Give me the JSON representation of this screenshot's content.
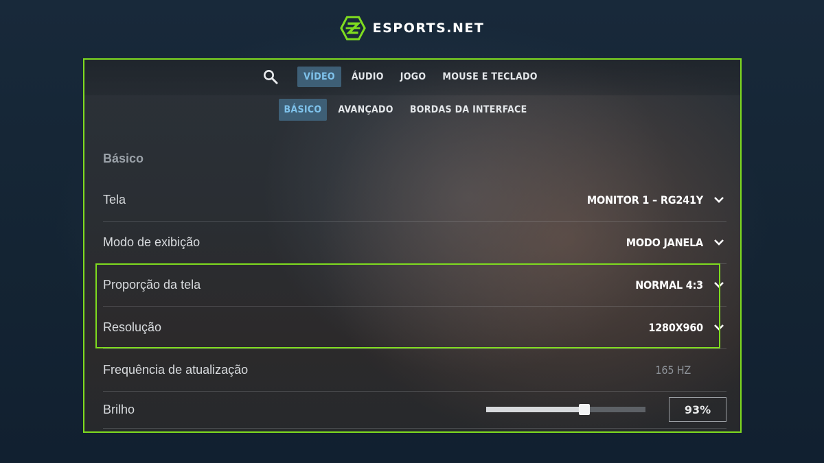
{
  "brand": {
    "name": "ESPORTS.NET",
    "accent": "#7fdc1f",
    "logo_icon": "esports-logo-icon"
  },
  "tabs": [
    {
      "label": "VÍDEO",
      "active": true
    },
    {
      "label": "ÁUDIO",
      "active": false
    },
    {
      "label": "JOGO",
      "active": false
    },
    {
      "label": "MOUSE E TECLADO",
      "active": false
    }
  ],
  "subtabs": [
    {
      "label": "BÁSICO",
      "active": true
    },
    {
      "label": "AVANÇADO",
      "active": false
    },
    {
      "label": "BORDAS DA INTERFACE",
      "active": false
    }
  ],
  "section": {
    "title": "Básico"
  },
  "settings": [
    {
      "label": "Tela",
      "value": "MONITOR 1 – RG241Y",
      "type": "dropdown"
    },
    {
      "label": "Modo de exibição",
      "value": "MODO JANELA",
      "type": "dropdown"
    },
    {
      "label": "Proporção da tela",
      "value": "NORMAL 4:3",
      "type": "dropdown",
      "highlighted": true
    },
    {
      "label": "Resolução",
      "value": "1280X960",
      "type": "dropdown",
      "highlighted": true
    },
    {
      "label": "Frequência de atualização",
      "value": "165 HZ",
      "type": "readonly"
    },
    {
      "label": "Brilho",
      "value": "93%",
      "type": "slider",
      "level": 0.6
    }
  ],
  "colors": {
    "active_tab_bg": "#3e5f76",
    "active_tab_text": "#7fc3ec",
    "highlight_border": "#7fdc1f"
  }
}
